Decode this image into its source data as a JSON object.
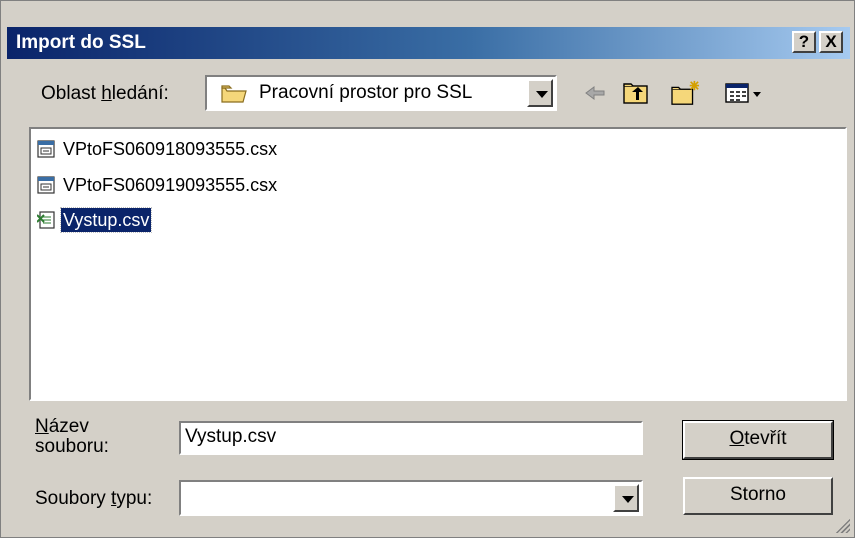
{
  "window": {
    "title": "Import do SSL",
    "help_label": "?",
    "close_label": "X"
  },
  "lookin": {
    "label_prefix": "Oblast ",
    "label_accel": "h",
    "label_suffix": "ledání:",
    "value": "Pracovní prostor pro SSL"
  },
  "toolbar": {
    "icons": [
      "back-icon",
      "up-folder-icon",
      "new-folder-icon",
      "view-menu-icon"
    ]
  },
  "files": [
    {
      "name": "VPtoFS060918093555.csx",
      "icon": "csx-file-icon",
      "selected": false
    },
    {
      "name": "VPtoFS060919093555.csx",
      "icon": "csx-file-icon",
      "selected": false
    },
    {
      "name": "Vystup.csv",
      "icon": "excel-csv-file-icon",
      "selected": true
    }
  ],
  "filename": {
    "label_accel": "N",
    "label_line1_rest": "ázev",
    "label_line2": "souboru:",
    "value": "Vystup.csv"
  },
  "filetype": {
    "label_prefix": "Soubory ",
    "label_accel": "t",
    "label_suffix": "ypu:",
    "value": ""
  },
  "buttons": {
    "open_accel": "O",
    "open_rest": "tevřít",
    "cancel": "Storno"
  }
}
